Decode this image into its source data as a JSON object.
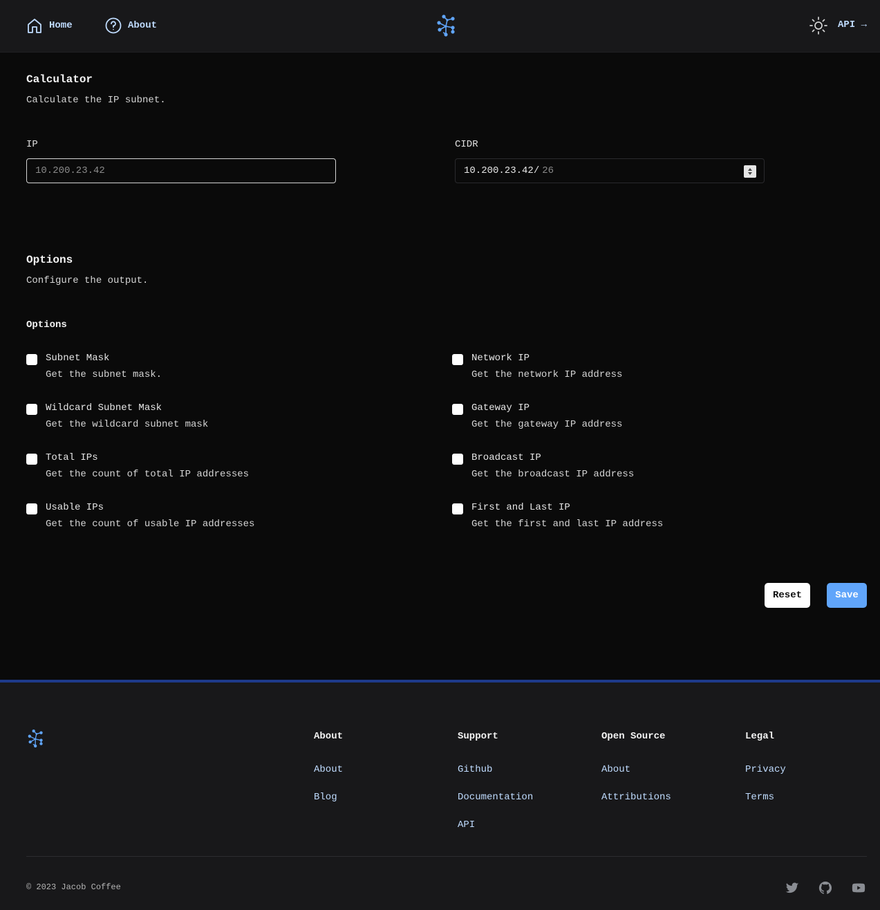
{
  "header": {
    "home_label": "Home",
    "about_label": "About",
    "api_label": "API →"
  },
  "calculator": {
    "title": "Calculator",
    "description": "Calculate the IP subnet.",
    "ip_label": "IP",
    "ip_placeholder": "10.200.23.42",
    "cidr_label": "CIDR",
    "cidr_prefix": "10.200.23.42/",
    "cidr_value": "26"
  },
  "options": {
    "title": "Options",
    "description": "Configure the output.",
    "group_label": "Options",
    "left": [
      {
        "title": "Subnet Mask",
        "desc": "Get the subnet mask."
      },
      {
        "title": "Wildcard Subnet Mask",
        "desc": "Get the wildcard subnet mask"
      },
      {
        "title": "Total IPs",
        "desc": "Get the count of total IP addresses"
      },
      {
        "title": "Usable IPs",
        "desc": "Get the count of usable IP addresses"
      }
    ],
    "right": [
      {
        "title": "Network IP",
        "desc": "Get the network IP address"
      },
      {
        "title": "Gateway IP",
        "desc": "Get the gateway IP address"
      },
      {
        "title": "Broadcast IP",
        "desc": "Get the broadcast IP address"
      },
      {
        "title": "First and Last IP",
        "desc": "Get the first and last IP address"
      }
    ]
  },
  "actions": {
    "reset_label": "Reset",
    "save_label": "Save"
  },
  "footer": {
    "columns": [
      {
        "title": "About",
        "links": [
          "About",
          "Blog"
        ]
      },
      {
        "title": "Support",
        "links": [
          "Github",
          "Documentation",
          "API"
        ]
      },
      {
        "title": "Open Source",
        "links": [
          "About",
          "Attributions"
        ]
      },
      {
        "title": "Legal",
        "links": [
          "Privacy",
          "Terms"
        ]
      }
    ],
    "copyright": "© 2023 Jacob Coffee",
    "social": [
      "twitter-icon",
      "github-icon",
      "youtube-icon"
    ]
  },
  "colors": {
    "accent": "#60a5fa",
    "link": "#bfdbfe",
    "footer_border": "#1e3a8a"
  }
}
